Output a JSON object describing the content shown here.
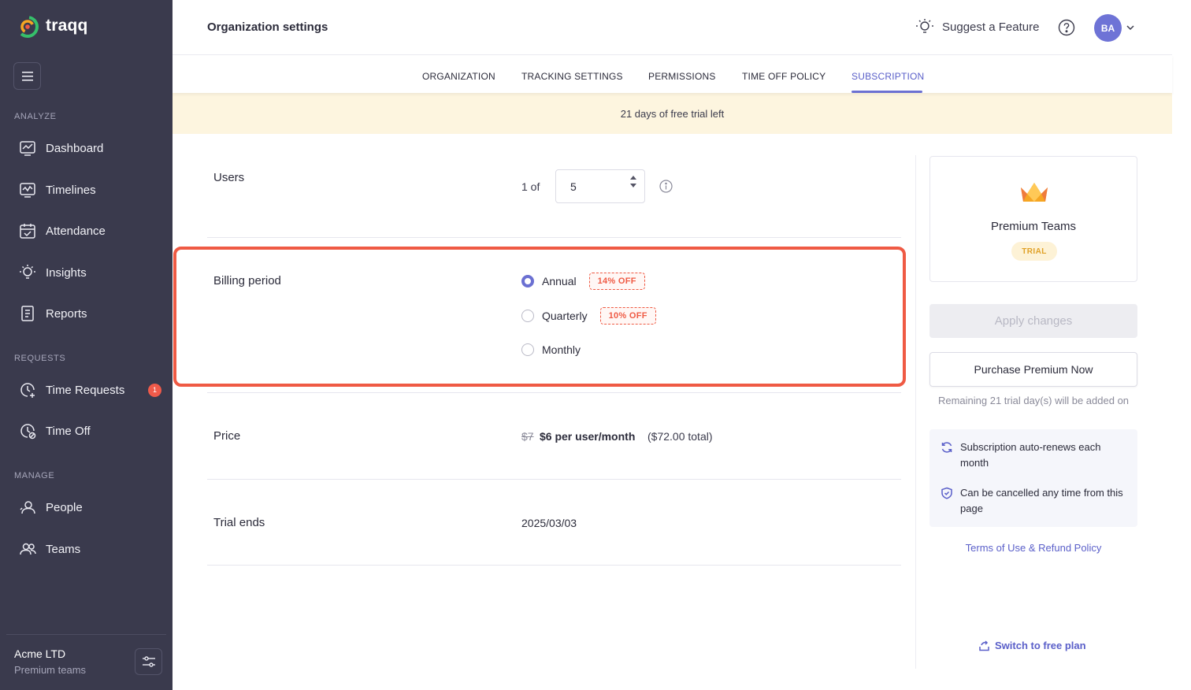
{
  "brand": {
    "name": "traqq"
  },
  "sidebar": {
    "sections": [
      {
        "title": "ANALYZE"
      },
      {
        "title": "REQUESTS"
      },
      {
        "title": "MANAGE"
      }
    ],
    "items": [
      {
        "label": "Dashboard"
      },
      {
        "label": "Timelines"
      },
      {
        "label": "Attendance"
      },
      {
        "label": "Insights"
      },
      {
        "label": "Reports"
      },
      {
        "label": "Time Requests",
        "badge": "1"
      },
      {
        "label": "Time Off"
      },
      {
        "label": "People"
      },
      {
        "label": "Teams"
      }
    ],
    "org": {
      "name": "Acme LTD",
      "plan": "Premium teams"
    }
  },
  "header": {
    "title": "Organization settings",
    "suggest_label": "Suggest a Feature",
    "avatar_initials": "BA"
  },
  "tabs": [
    {
      "label": "ORGANIZATION",
      "active": false
    },
    {
      "label": "TRACKING SETTINGS",
      "active": false
    },
    {
      "label": "PERMISSIONS",
      "active": false
    },
    {
      "label": "TIME OFF POLICY",
      "active": false
    },
    {
      "label": "SUBSCRIPTION",
      "active": true
    }
  ],
  "trial_banner": "21 days of free trial left",
  "users": {
    "label": "Users",
    "prefix": "1 of",
    "value": "5"
  },
  "billing": {
    "label": "Billing period",
    "options": [
      {
        "label": "Annual",
        "discount": "14% OFF",
        "selected": true
      },
      {
        "label": "Quarterly",
        "discount": "10% OFF",
        "selected": false
      },
      {
        "label": "Monthly",
        "discount": "",
        "selected": false
      }
    ]
  },
  "price": {
    "label": "Price",
    "old": "$7",
    "new": "$6 per user/month",
    "total": "($72.00 total)"
  },
  "trial_ends": {
    "label": "Trial ends",
    "date": "2025/03/03"
  },
  "plan_card": {
    "name": "Premium Teams",
    "badge": "TRIAL"
  },
  "actions": {
    "apply_label": "Apply changes",
    "purchase_label": "Purchase Premium Now",
    "remaining_text": "Remaining 21 trial day(s) will be added on"
  },
  "features": [
    {
      "text": "Subscription auto-renews each month"
    },
    {
      "text": "Can be cancelled any time from this page"
    }
  ],
  "links": {
    "terms": "Terms of Use & Refund Policy",
    "switch_free": "Switch to free plan"
  },
  "colors": {
    "sidebar_bg": "#3a3a4d",
    "accent": "#6b70d2",
    "highlight_border": "#ef5a44",
    "trial_banner_bg": "#fdf5df",
    "badge_red": "#ef5a4a"
  }
}
